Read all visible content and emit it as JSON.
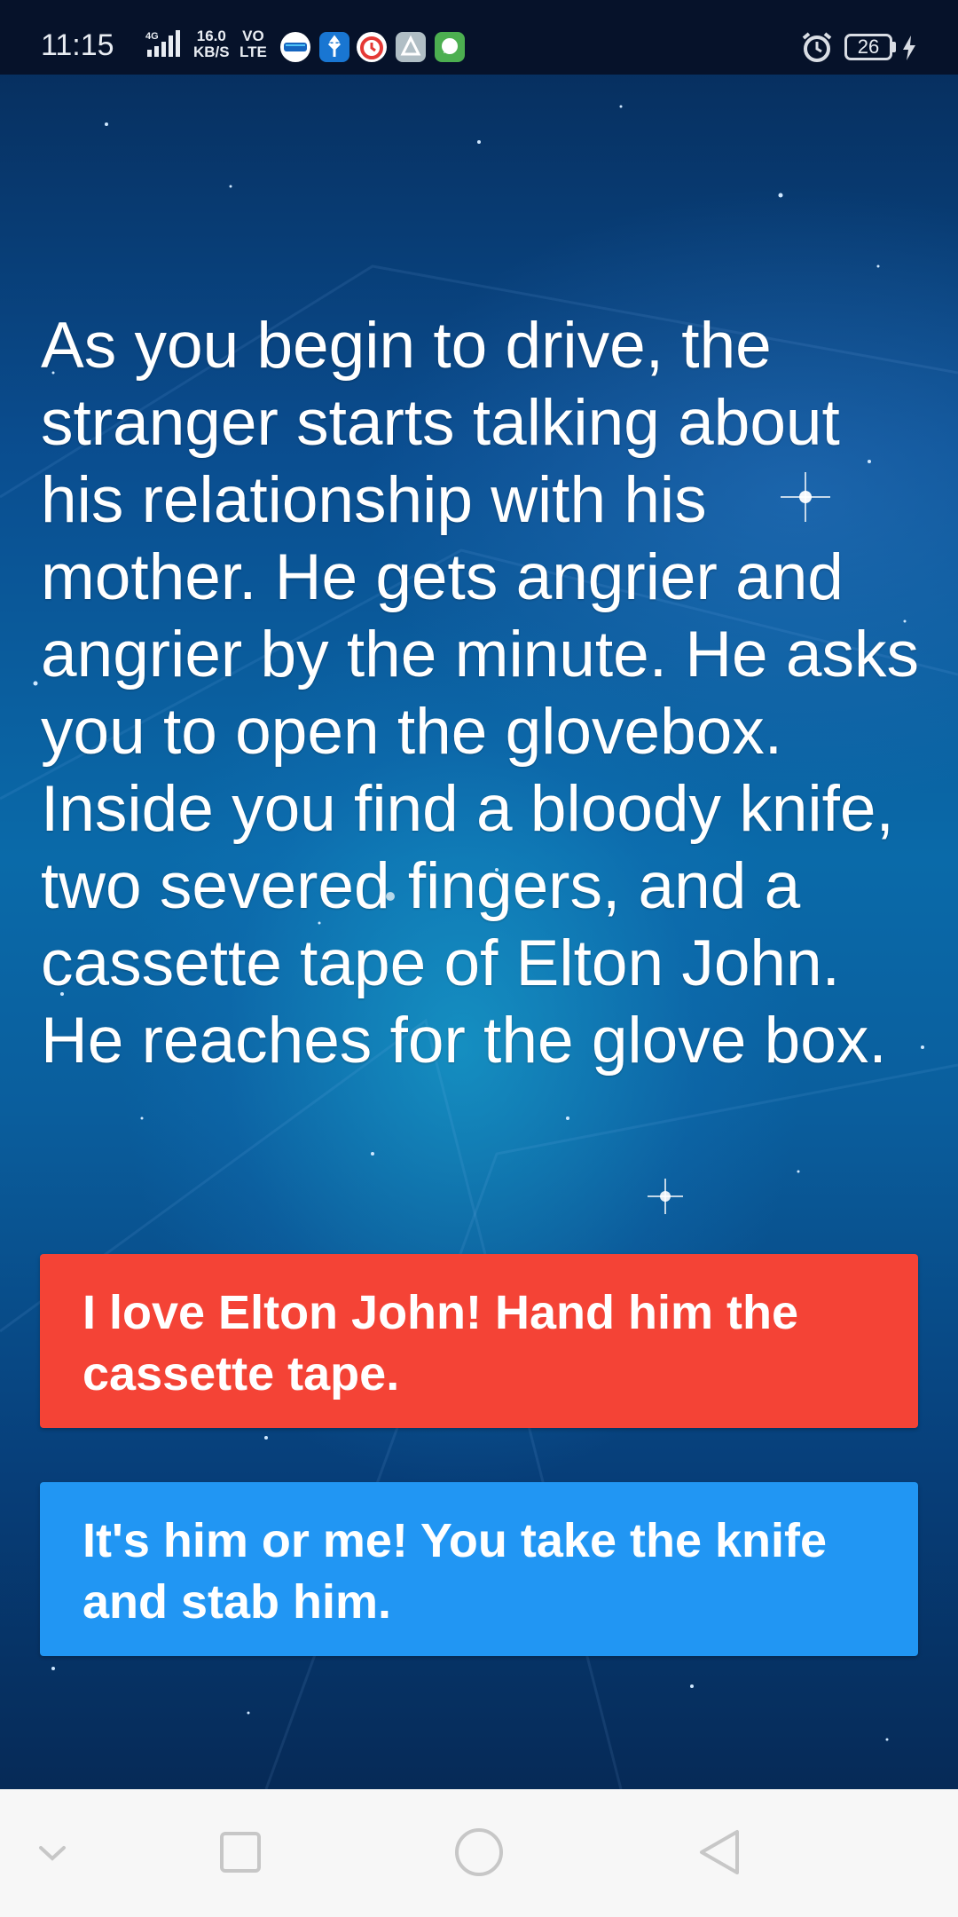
{
  "status_bar": {
    "time": "11:15",
    "network_type": "4G",
    "net_speed_value": "16.0",
    "net_speed_unit": "KB/S",
    "volte_top": "VO",
    "volte_bottom": "LTE",
    "app_icons": [
      "paytm-icon",
      "usb-icon",
      "alarm-app-icon",
      "files-icon",
      "chat-app-icon"
    ],
    "battery_level": "26"
  },
  "story": {
    "text": "As you begin to drive, the stranger starts talking about his relationship with his mother. He gets angrier and angrier by the minute. He asks you to open the glovebox. Inside you find a bloody knife, two severed fingers, and a cassette tape of Elton John. He reaches for the glove box."
  },
  "choices": [
    {
      "label": "I love Elton John! Hand him the cassette tape.",
      "color": "#f44336"
    },
    {
      "label": "It's him or me! You take the knife and stab him.",
      "color": "#2196f3"
    }
  ],
  "nav_bar": {
    "buttons": [
      "chevron-down-icon",
      "recents-square-icon",
      "home-circle-icon",
      "back-triangle-icon"
    ]
  }
}
